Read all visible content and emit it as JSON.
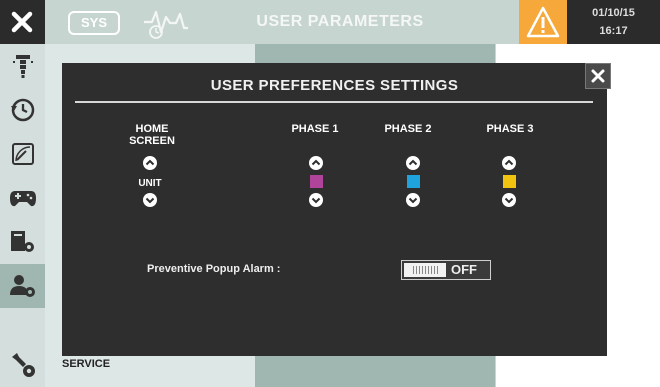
{
  "header": {
    "sys_label": "SYS",
    "title": "USER PARAMETERS",
    "date": "01/10/15",
    "time": "16:17",
    "icons": [
      "close-icon",
      "heartbeat-clock-icon",
      "warning-icon"
    ]
  },
  "sidebar": {
    "items": [
      {
        "icon": "fan-icon"
      },
      {
        "icon": "history-icon"
      },
      {
        "icon": "gauge-icon"
      },
      {
        "icon": "gamepad-icon"
      },
      {
        "icon": "device-settings-icon"
      },
      {
        "icon": "user-settings-icon",
        "active": true
      },
      {
        "icon": "wrench-gear-icon"
      }
    ],
    "service_label": "SERVICE"
  },
  "modal": {
    "title": "USER PREFERENCES SETTINGS",
    "columns": {
      "home": "HOME SCREEN",
      "phase1": "PHASE 1",
      "phase2": "PHASE 2",
      "phase3": "PHASE 3"
    },
    "home_value": "UNIT",
    "phase_colors": {
      "phase1": "#b0449a",
      "phase2": "#1fa3dd",
      "phase3": "#f1c40f"
    },
    "alarm_label": "Preventive Popup Alarm :",
    "alarm_state": "OFF"
  },
  "colors": {
    "topbar": "#c7d5d1",
    "dark": "#2b2b2b",
    "alert": "#f6a83a",
    "modal_bg": "#2e2e2e"
  }
}
